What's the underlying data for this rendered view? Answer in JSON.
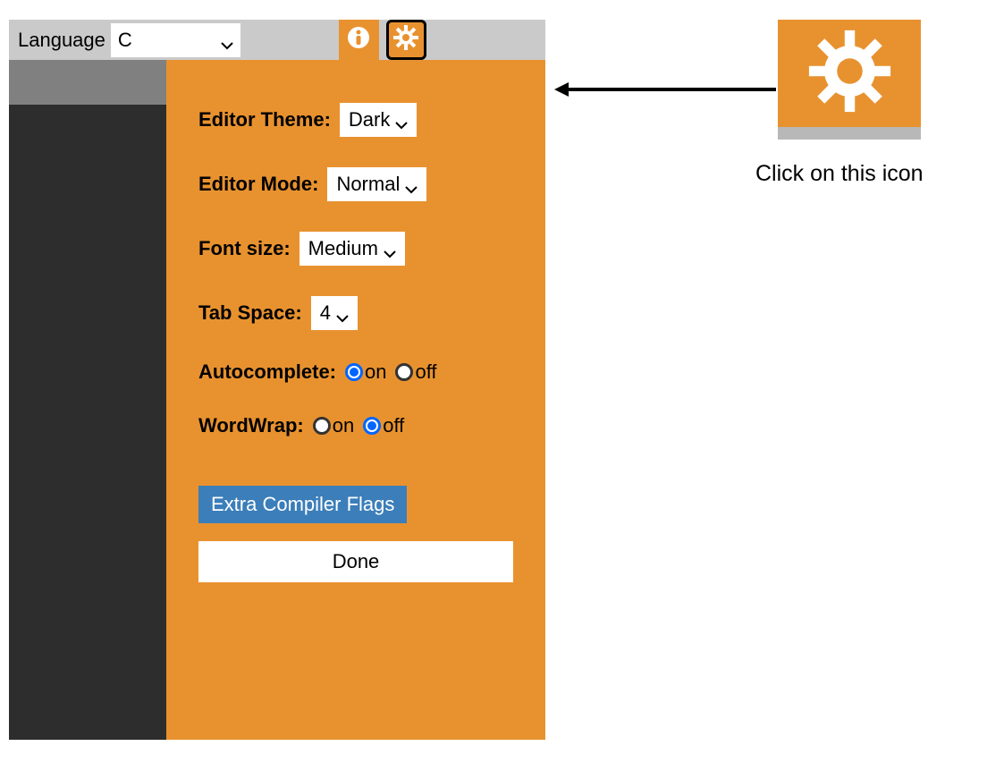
{
  "topbar": {
    "language_label": "Language",
    "language_value": "C"
  },
  "settings": {
    "editor_theme_label": "Editor Theme:",
    "editor_theme_value": "Dark",
    "editor_mode_label": "Editor Mode:",
    "editor_mode_value": "Normal",
    "font_size_label": "Font size:",
    "font_size_value": "Medium",
    "tab_space_label": "Tab Space:",
    "tab_space_value": "4",
    "autocomplete_label": "Autocomplete:",
    "autocomplete_on": "on",
    "autocomplete_off": "off",
    "autocomplete_value": "on",
    "wordwrap_label": "WordWrap:",
    "wordwrap_on": "on",
    "wordwrap_off": "off",
    "wordwrap_value": "off",
    "compiler_flags_btn": "Extra Compiler Flags",
    "done_btn": "Done"
  },
  "callout": {
    "text": "Click on this icon"
  }
}
